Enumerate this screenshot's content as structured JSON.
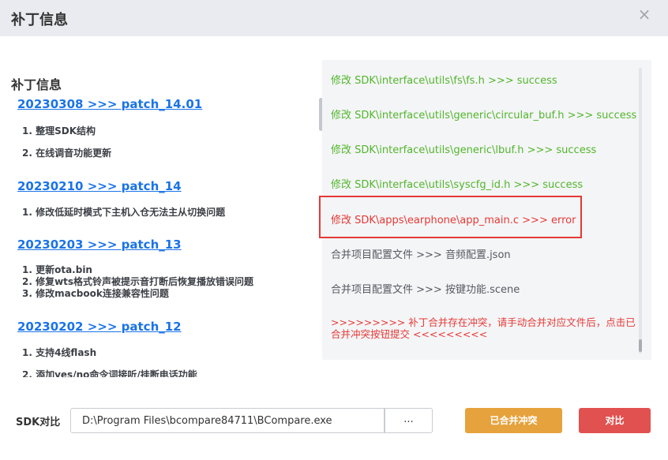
{
  "dialog": {
    "title": "补丁信息",
    "close_glyph": "×"
  },
  "left": {
    "heading": "补丁信息",
    "patches": [
      {
        "link": "20230308 >>> patch_14.01",
        "items": [
          "1. 整理SDK结构",
          "2. 在线调音功能更新"
        ]
      },
      {
        "link": "20230210 >>> patch_14",
        "items": [
          "1. 修改低延时模式下主机入仓无法主从切换问题"
        ]
      },
      {
        "link": "20230203 >>> patch_13",
        "items": [
          "1. 更新ota.bin",
          "2. 修复wts格式铃声被提示音打断后恢复播放错误问题",
          "3. 修改macbook连接兼容性问题"
        ]
      },
      {
        "link": "20230202 >>> patch_12",
        "items": [
          "1. 支持4线flash",
          "2. 添加yes/no命令词接听/挂断电话功能"
        ]
      }
    ]
  },
  "log": {
    "lines": [
      {
        "text": "修改 SDK\\interface\\utils\\fs\\fs.h >>> success",
        "status": "success"
      },
      {
        "text": "修改 SDK\\interface\\utils\\generic\\circular_buf.h >>> success",
        "status": "success"
      },
      {
        "text": "修改 SDK\\interface\\utils\\generic\\lbuf.h >>> success",
        "status": "success"
      },
      {
        "text": "修改 SDK\\interface\\utils\\syscfg_id.h >>> success",
        "status": "success"
      },
      {
        "text": "修改 SDK\\apps\\earphone\\app_main.c >>> error",
        "status": "error"
      },
      {
        "text": "合并项目配置文件 >>> 音频配置.json",
        "status": "info"
      },
      {
        "text": "合并项目配置文件 >>> 按键功能.scene",
        "status": "info"
      },
      {
        "text": ">>>>>>>>> 补丁合并存在冲突，请手动合并对应文件后，点击已合并冲突按钮提交 <<<<<<<<<",
        "status": "conflict"
      }
    ]
  },
  "footer": {
    "sdk_label": "SDK对比",
    "sdk_path": "D:\\Program Files\\bcompare84711\\BCompare.exe",
    "browse_label": "...",
    "merged_label": "已合并冲突",
    "compare_label": "对比"
  },
  "colors": {
    "success": "#52b62b",
    "error": "#e53935",
    "link": "#1a73e8",
    "merged_button": "#e6a23c",
    "compare_button": "#e0514f"
  }
}
